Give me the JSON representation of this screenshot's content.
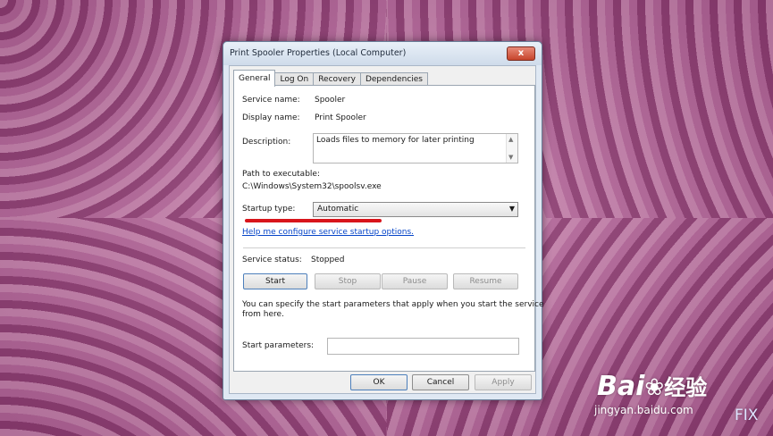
{
  "window": {
    "title": "Print Spooler Properties (Local Computer)",
    "close_glyph": "x"
  },
  "tabs": [
    {
      "label": "General",
      "active": true
    },
    {
      "label": "Log On",
      "active": false
    },
    {
      "label": "Recovery",
      "active": false
    },
    {
      "label": "Dependencies",
      "active": false
    }
  ],
  "general": {
    "service_name_label": "Service name:",
    "service_name": "Spooler",
    "display_name_label": "Display name:",
    "display_name": "Print Spooler",
    "description_label": "Description:",
    "description": "Loads files to memory for later printing",
    "path_label": "Path to executable:",
    "path": "C:\\Windows\\System32\\spoolsv.exe",
    "startup_type_label": "Startup type:",
    "startup_type": "Automatic",
    "help_link": "Help me configure service startup options.",
    "service_status_label": "Service status:",
    "service_status": "Stopped",
    "buttons": {
      "start": "Start",
      "stop": "Stop",
      "pause": "Pause",
      "resume": "Resume"
    },
    "params_note_line1": "You can specify the start parameters that apply when you start the service",
    "params_note_line2": "from here.",
    "start_parameters_label": "Start parameters:",
    "start_parameters_value": ""
  },
  "footer": {
    "ok": "OK",
    "cancel": "Cancel",
    "apply": "Apply"
  },
  "watermark": {
    "brand": "Bai",
    "brand_suffix": "经验",
    "url": "jingyan.baidu.com",
    "fix": "FIX"
  },
  "colors": {
    "highlight_underline": "#d8151b",
    "link": "#0645c8"
  }
}
